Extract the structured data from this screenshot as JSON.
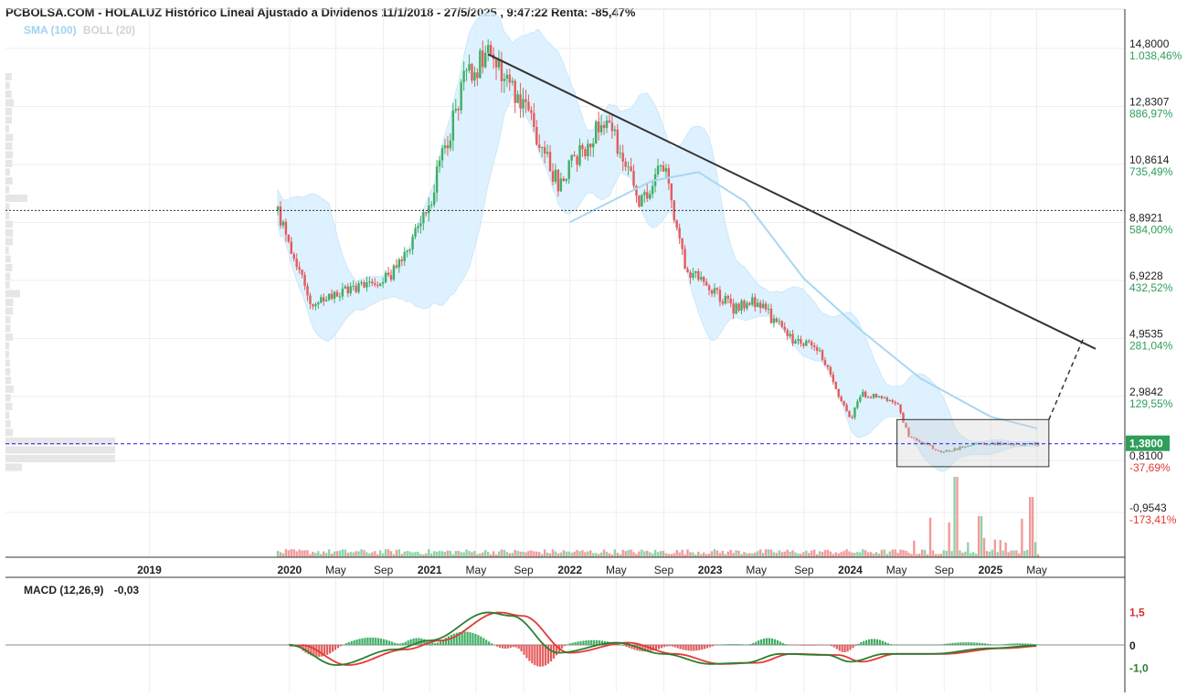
{
  "header": {
    "title": "PCBOLSA.COM - HOLALUZ Histórico Lineal Ajustado a Dividenos 11/1/2018 - 27/5/2025 , 9:47:22 Renta: -85,47%",
    "indicators": [
      {
        "name": "SMA (100)",
        "color": "#9fd4f2"
      },
      {
        "name": "BOLL (20)",
        "color": "#d2d2d2"
      }
    ]
  },
  "macd_panel": {
    "label": "MACD (12,26,9)",
    "value": "-0,03",
    "ticks": [
      {
        "value": 1.5,
        "label": "1,5",
        "color": "#d32f2f"
      },
      {
        "value": 0,
        "label": "0",
        "color": "#222222"
      },
      {
        "value": -1.0,
        "label": "-1,0",
        "color": "#2e7d32"
      }
    ]
  },
  "colors": {
    "up": "#3fae63",
    "down": "#e55b5b",
    "band": "#d9efff",
    "sma": "#a9d7f2",
    "price_line": "#1a1aff",
    "trendline": "#333333"
  },
  "chart_data": [
    {
      "type": "candlestick",
      "title": "PCBOLSA.COM - HOLALUZ Histórico Lineal Ajustado a Dividenos 11/1/2018 - 27/5/2025 , 9:47:22 Renta: -85,47%",
      "x_axis_labels": [
        "2019",
        "2020",
        "May",
        "Sep",
        "2021",
        "May",
        "Sep",
        "2022",
        "May",
        "Sep",
        "2023",
        "May",
        "Sep",
        "2024",
        "May",
        "Sep",
        "2025",
        "May"
      ],
      "y_ticks": [
        {
          "value": 14.8,
          "label": "14,8000",
          "pct": "1.038,46%",
          "pct_color": "#2e9e5a"
        },
        {
          "value": 12.8307,
          "label": "12,8307",
          "pct": "886,97%",
          "pct_color": "#2e9e5a"
        },
        {
          "value": 10.8614,
          "label": "10,8614",
          "pct": "735,49%",
          "pct_color": "#2e9e5a"
        },
        {
          "value": 8.8921,
          "label": "8,8921",
          "pct": "584,00%",
          "pct_color": "#2e9e5a"
        },
        {
          "value": 6.9228,
          "label": "6,9228",
          "pct": "432,52%",
          "pct_color": "#2e9e5a"
        },
        {
          "value": 4.9535,
          "label": "4,9535",
          "pct": "281,04%",
          "pct_color": "#2e9e5a"
        },
        {
          "value": 2.9842,
          "label": "2,9842",
          "pct": "129,55%",
          "pct_color": "#2e9e5a"
        },
        {
          "value": 0.81,
          "label": "0,8100",
          "pct": "-37,69%",
          "pct_color": "#e53935"
        },
        {
          "value": -0.9543,
          "label": "-0,9543",
          "pct": "-173,41%",
          "pct_color": "#e53935"
        }
      ],
      "current_price": {
        "value": 1.38,
        "label": "1,3800"
      },
      "reference_level": 9.3,
      "anchor_points": [
        {
          "date": "2019-12",
          "value": 9.3
        },
        {
          "date": "2020-03",
          "value": 6.0
        },
        {
          "date": "2020-06",
          "value": 6.6
        },
        {
          "date": "2020-10",
          "value": 7.2
        },
        {
          "date": "2021-01",
          "value": 9.6
        },
        {
          "date": "2021-04",
          "value": 13.8
        },
        {
          "date": "2021-06",
          "value": 14.6
        },
        {
          "date": "2021-09",
          "value": 13.0
        },
        {
          "date": "2021-12",
          "value": 10.2
        },
        {
          "date": "2022-04",
          "value": 12.5
        },
        {
          "date": "2022-05",
          "value": 11.6
        },
        {
          "date": "2022-07",
          "value": 9.5
        },
        {
          "date": "2022-09",
          "value": 10.8
        },
        {
          "date": "2022-11",
          "value": 7.3
        },
        {
          "date": "2023-03",
          "value": 6.0
        },
        {
          "date": "2023-05",
          "value": 6.2
        },
        {
          "date": "2023-08",
          "value": 4.9
        },
        {
          "date": "2023-10",
          "value": 4.8
        },
        {
          "date": "2024-01",
          "value": 2.2
        },
        {
          "date": "2024-02",
          "value": 3.1
        },
        {
          "date": "2024-05",
          "value": 2.8
        },
        {
          "date": "2024-06",
          "value": 1.6
        },
        {
          "date": "2024-09",
          "value": 1.1
        },
        {
          "date": "2024-12",
          "value": 1.4
        },
        {
          "date": "2025-03",
          "value": 1.35
        },
        {
          "date": "2025-05",
          "value": 1.38
        }
      ],
      "sma_points": [
        {
          "date": "2022-01",
          "value": 8.9
        },
        {
          "date": "2022-08",
          "value": 10.3
        },
        {
          "date": "2022-12",
          "value": 10.6
        },
        {
          "date": "2023-04",
          "value": 9.6
        },
        {
          "date": "2023-09",
          "value": 7.0
        },
        {
          "date": "2024-02",
          "value": 5.2
        },
        {
          "date": "2024-07",
          "value": 3.6
        },
        {
          "date": "2025-01",
          "value": 2.3
        },
        {
          "date": "2025-05",
          "value": 1.9
        }
      ],
      "trendline": {
        "from": {
          "date": "2021-06",
          "value": 14.6
        },
        "to": {
          "date": "2025-10",
          "value": 4.6
        }
      },
      "range_box": {
        "from_date": "2024-05",
        "to_date": "2025-06",
        "high": 2.2,
        "low": 0.6
      }
    },
    {
      "type": "bar",
      "title": "MACD (12,26,9)",
      "current_value": -0.03,
      "macd_points": [
        {
          "date": "2020-01",
          "value": 0.0
        },
        {
          "date": "2020-05",
          "value": -0.9
        },
        {
          "date": "2020-10",
          "value": -0.2
        },
        {
          "date": "2021-01",
          "value": 0.2
        },
        {
          "date": "2021-06",
          "value": 1.45
        },
        {
          "date": "2021-08",
          "value": 1.3
        },
        {
          "date": "2021-12",
          "value": -0.35
        },
        {
          "date": "2022-05",
          "value": 0.1
        },
        {
          "date": "2022-09",
          "value": -0.4
        },
        {
          "date": "2023-01",
          "value": -0.85
        },
        {
          "date": "2023-04",
          "value": -0.8
        },
        {
          "date": "2023-07",
          "value": -0.4
        },
        {
          "date": "2023-11",
          "value": -0.45
        },
        {
          "date": "2024-01",
          "value": -0.75
        },
        {
          "date": "2024-04",
          "value": -0.4
        },
        {
          "date": "2024-08",
          "value": -0.4
        },
        {
          "date": "2025-01",
          "value": -0.15
        },
        {
          "date": "2025-05",
          "value": -0.03
        }
      ]
    }
  ]
}
